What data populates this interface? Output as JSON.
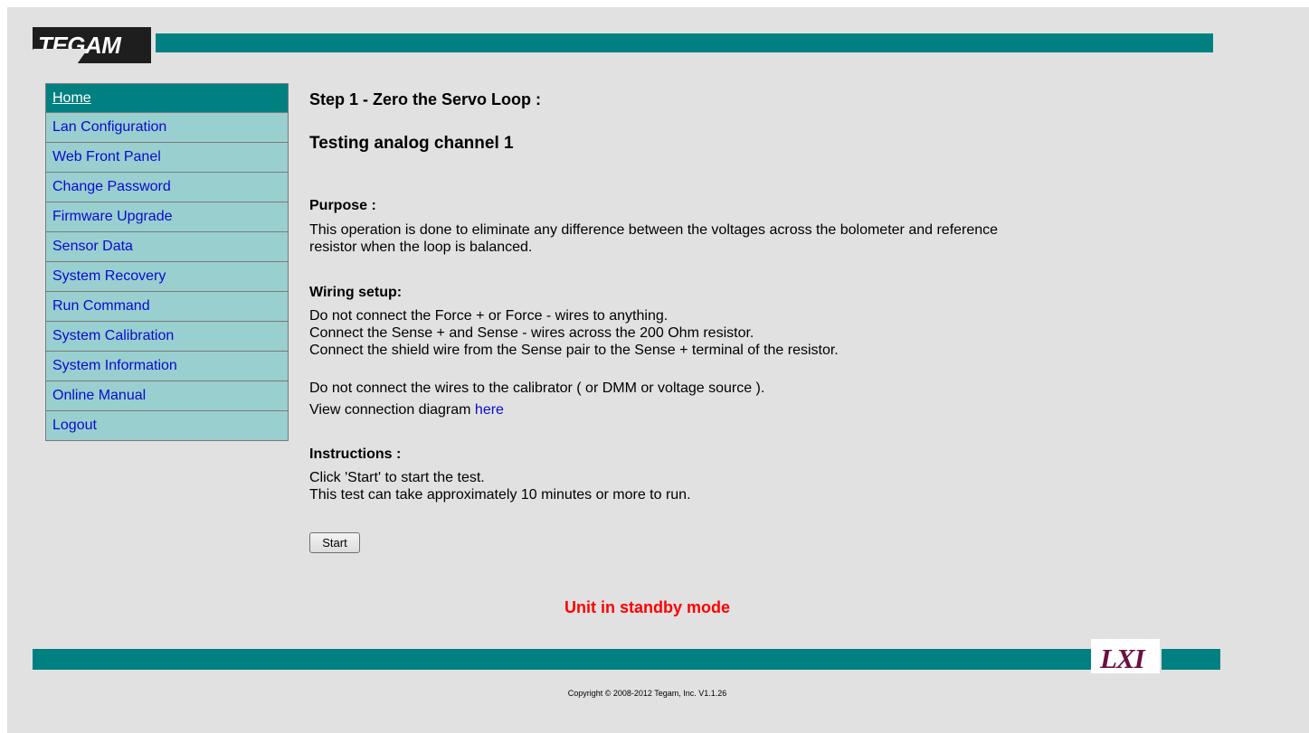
{
  "header": {
    "logo_text": "TEGAM"
  },
  "sidebar": {
    "items": [
      {
        "label": "Home"
      },
      {
        "label": "Lan Configuration"
      },
      {
        "label": "Web Front Panel"
      },
      {
        "label": "Change Password"
      },
      {
        "label": "Firmware Upgrade"
      },
      {
        "label": "Sensor Data"
      },
      {
        "label": "System Recovery"
      },
      {
        "label": "Run Command"
      },
      {
        "label": "System Calibration"
      },
      {
        "label": "System Information"
      },
      {
        "label": "Online Manual"
      },
      {
        "label": "Logout"
      }
    ]
  },
  "main": {
    "step_title": "Step 1 - Zero the Servo Loop :",
    "channel_title": "Testing analog channel 1",
    "purpose": {
      "heading": "Purpose :",
      "lines": [
        "This operation is done to eliminate any difference between the voltages across the bolometer and reference",
        "resistor when the loop is balanced."
      ]
    },
    "wiring": {
      "heading": "Wiring setup:",
      "lines": [
        "Do not connect the Force + or Force - wires to anything.",
        "Connect the Sense + and Sense - wires across the 200 Ohm resistor.",
        "Connect the shield wire from the Sense pair to the Sense + terminal of the resistor."
      ],
      "note": "Do not connect the wires to the calibrator ( or DMM or voltage source ).",
      "diagram_prefix": "View connection diagram ",
      "diagram_link": "here"
    },
    "instructions": {
      "heading": "Instructions :",
      "lines": [
        "Click 'Start' to start the test.",
        "This test can take approximately 10 minutes or more to run."
      ]
    },
    "start_label": "Start",
    "status_text": "Unit in standby mode"
  },
  "footer": {
    "lxi_text": "LXI",
    "copyright": "Copyright © 2008-2012 Tegam, Inc. V1.1.26"
  },
  "colors": {
    "teal": "#008080",
    "nav_bg": "#99cfcf",
    "link": "#0a0ad0",
    "status": "#ff0000"
  }
}
